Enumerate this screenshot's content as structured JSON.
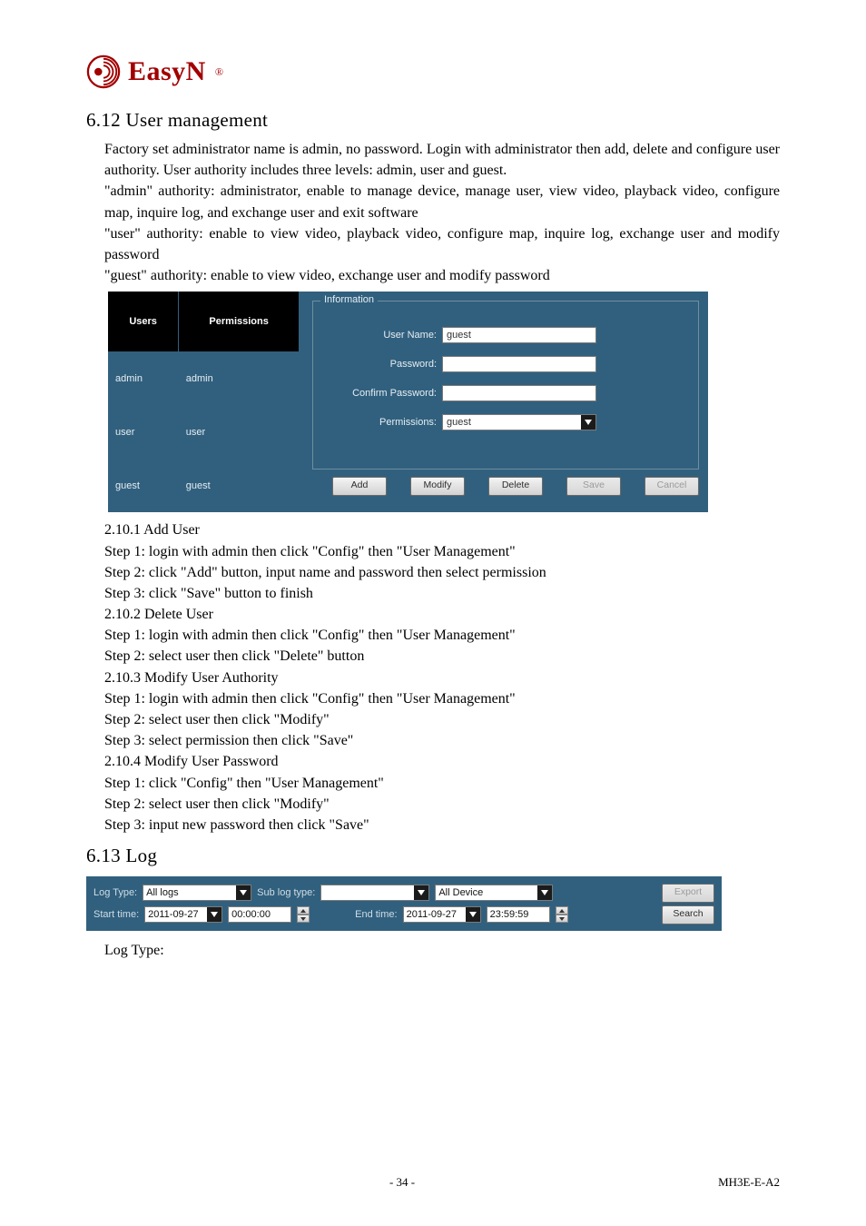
{
  "logo": {
    "word": "EasyN",
    "reg": "®"
  },
  "section_612": {
    "heading": "6.12 User management",
    "para1": "Factory set administrator name is admin, no password. Login with administrator then add, delete and configure user authority. User authority includes three levels: admin, user and guest.",
    "para2": "\"admin\" authority: administrator, enable to manage device, manage user, view video, playback video, configure map, inquire log, and exchange user and exit software",
    "para3": " \"user\" authority: enable to view video, playback video, configure map, inquire log, exchange user and modify password",
    "para4": "\"guest\" authority: enable to view video, exchange user and modify password"
  },
  "um": {
    "headers": {
      "users": "Users",
      "perms": "Permissions"
    },
    "rows": [
      {
        "user": "admin",
        "perm": "admin"
      },
      {
        "user": "user",
        "perm": "user"
      },
      {
        "user": "guest",
        "perm": "guest"
      }
    ],
    "info_legend": "Information",
    "labels": {
      "username": "User Name:",
      "password": "Password:",
      "confirm": "Confirm Password:",
      "perms": "Permissions:"
    },
    "values": {
      "username": "guest",
      "perms": "guest"
    },
    "buttons": {
      "add": "Add",
      "modify": "Modify",
      "delete": "Delete",
      "save": "Save",
      "cancel": "Cancel"
    }
  },
  "steps": {
    "t2101": "2.10.1 Add User",
    "s2101_1": "Step 1: login with admin then click \"Config\" then \"User Management\"",
    "s2101_2": "Step 2: click \"Add\" button, input name and password then select permission",
    "s2101_3": "Step 3: click \"Save\" button to finish",
    "t2102": "2.10.2 Delete User",
    "s2102_1": "Step 1: login with admin then click \"Config\" then \"User Management\"",
    "s2102_2": "Step 2: select user then click \"Delete\" button",
    "t2103": "2.10.3 Modify User Authority",
    "s2103_1": "Step 1: login with admin then click \"Config\" then \"User Management\"",
    "s2103_2": "Step 2: select user then click \"Modify\"",
    "s2103_3": "Step 3: select permission then click \"Save\"",
    "t2104": "2.10.4 Modify User Password",
    "s2104_1": "Step 1: click \"Config\" then \"User Management\"",
    "s2104_2": "Step 2: select user then click \"Modify\"",
    "s2104_3": "Step 3: input new password then click \"Save\""
  },
  "section_613": {
    "heading": "6.13 Log"
  },
  "log": {
    "labels": {
      "logtype": "Log Type:",
      "sublog": "Sub log type:",
      "device": "All Device",
      "start": "Start time:",
      "end": "End time:"
    },
    "values": {
      "logtype": "All logs",
      "sublog": "",
      "start_date": "2011-09-27",
      "start_time": "00:00:00",
      "end_date": "2011-09-27",
      "end_time": "23:59:59"
    },
    "buttons": {
      "export": "Export",
      "search": "Search"
    }
  },
  "after_log": "Log Type:",
  "footer": {
    "page": "- 34 -",
    "doc": "MH3E-E-A2"
  }
}
